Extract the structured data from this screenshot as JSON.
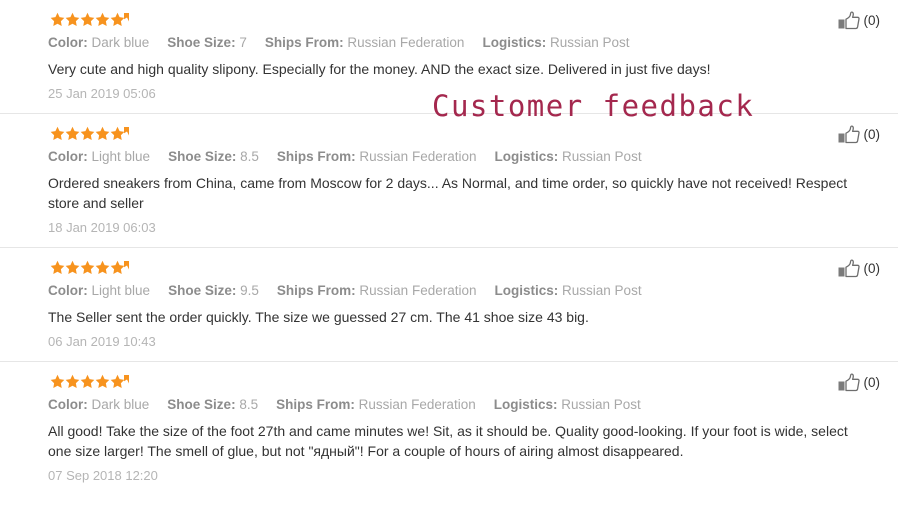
{
  "watermark": {
    "text": "Customer feedback",
    "color": "#a4284e"
  },
  "labels": {
    "color": "Color:",
    "shoe_size": "Shoe Size:",
    "ships_from": "Ships From:",
    "logistics": "Logistics:"
  },
  "icons": {
    "star": "star-icon",
    "thumbs_up": "thumbs-up-icon"
  },
  "theme": {
    "star_color": "#f7931e",
    "separator_color": "#e6e6e6",
    "label_color": "#8c8c8c",
    "value_color": "#a8a8a8",
    "text_color": "#333333",
    "date_color": "#b5b5b5"
  },
  "reviews": [
    {
      "rating": 5,
      "stars_display": "★★★★★",
      "color": "Dark blue",
      "shoe_size": "7",
      "ships_from": "Russian Federation",
      "logistics": "Russian Post",
      "text": "Very cute and high quality slipony. Especially for the money. AND the exact size. Delivered in just five days!",
      "date": "25 Jan 2019 05:06",
      "helpful_count": "(0)"
    },
    {
      "rating": 5,
      "stars_display": "★★★★★",
      "color": "Light blue",
      "shoe_size": "8.5",
      "ships_from": "Russian Federation",
      "logistics": "Russian Post",
      "text": "Ordered sneakers from China, came from Moscow for 2 days... As Normal, and time order, so quickly have not received! Respect store and seller",
      "date": "18 Jan 2019 06:03",
      "helpful_count": "(0)"
    },
    {
      "rating": 5,
      "stars_display": "★★★★★",
      "color": "Light blue",
      "shoe_size": "9.5",
      "ships_from": "Russian Federation",
      "logistics": "Russian Post",
      "text": "The Seller sent the order quickly. The size we guessed 27 cm. The 41 shoe size 43 big.",
      "date": "06 Jan 2019 10:43",
      "helpful_count": "(0)"
    },
    {
      "rating": 5,
      "stars_display": "★★★★★",
      "color": "Dark blue",
      "shoe_size": "8.5",
      "ships_from": "Russian Federation",
      "logistics": "Russian Post",
      "text": "All good! Take the size of the foot 27th and came minutes we! Sit, as it should be. Quality good-looking. If your foot is wide, select one size larger! The smell of glue, but not \"ядный\"! For a couple of hours of airing almost disappeared.",
      "date": "07 Sep 2018 12:20",
      "helpful_count": "(0)"
    }
  ]
}
